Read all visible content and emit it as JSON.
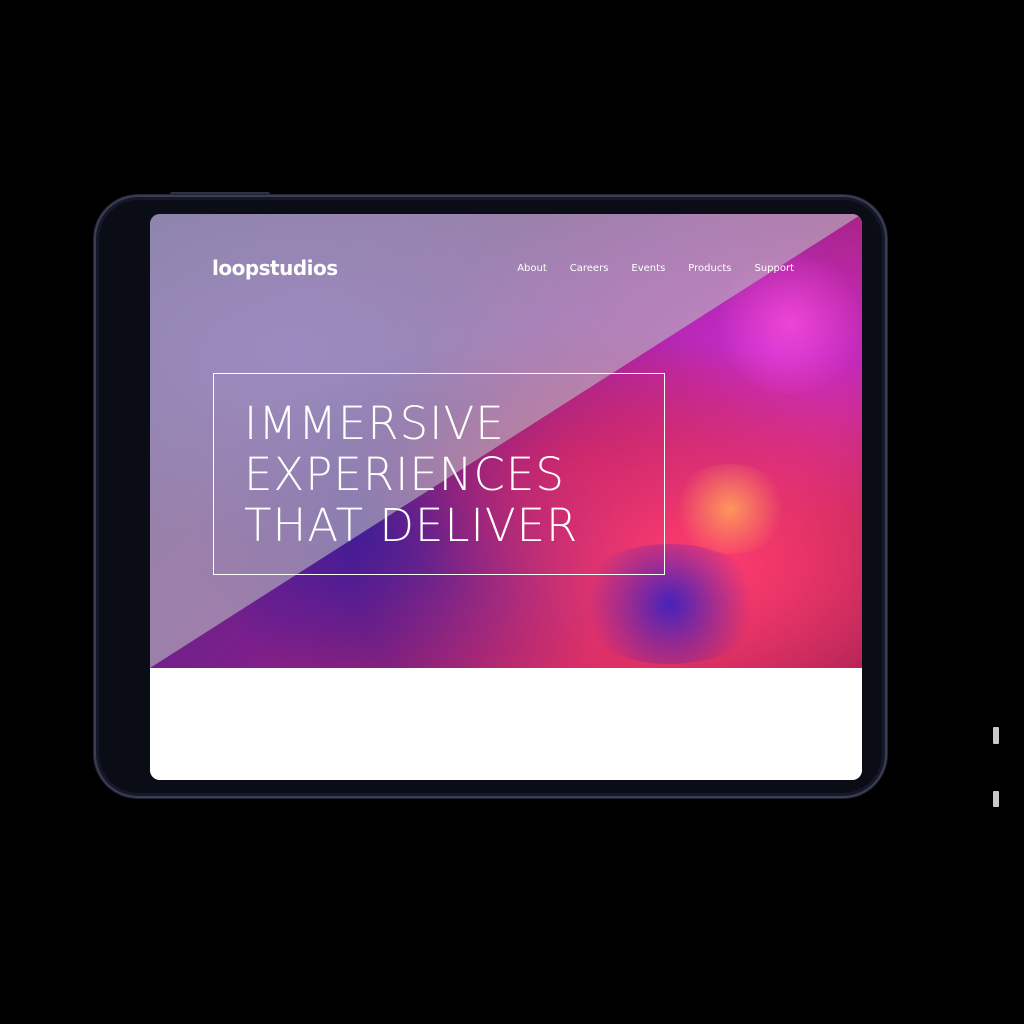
{
  "site": {
    "logo": "loopstudios"
  },
  "nav": {
    "items": [
      {
        "label": "About"
      },
      {
        "label": "Careers"
      },
      {
        "label": "Events"
      },
      {
        "label": "Products"
      },
      {
        "label": "Support"
      }
    ]
  },
  "hero": {
    "headline": "IMMERSIVE\nEXPERIENCES\nTHAT DELIVER"
  },
  "colors": {
    "page_background": "#000000",
    "device_frame": "#0b0d16",
    "overlay_gray": "#b9b9c0",
    "hero_magenta": "#c3245e",
    "hero_purple": "#7a1f8c",
    "text_white": "#ffffff",
    "lower_section": "#ffffff"
  }
}
